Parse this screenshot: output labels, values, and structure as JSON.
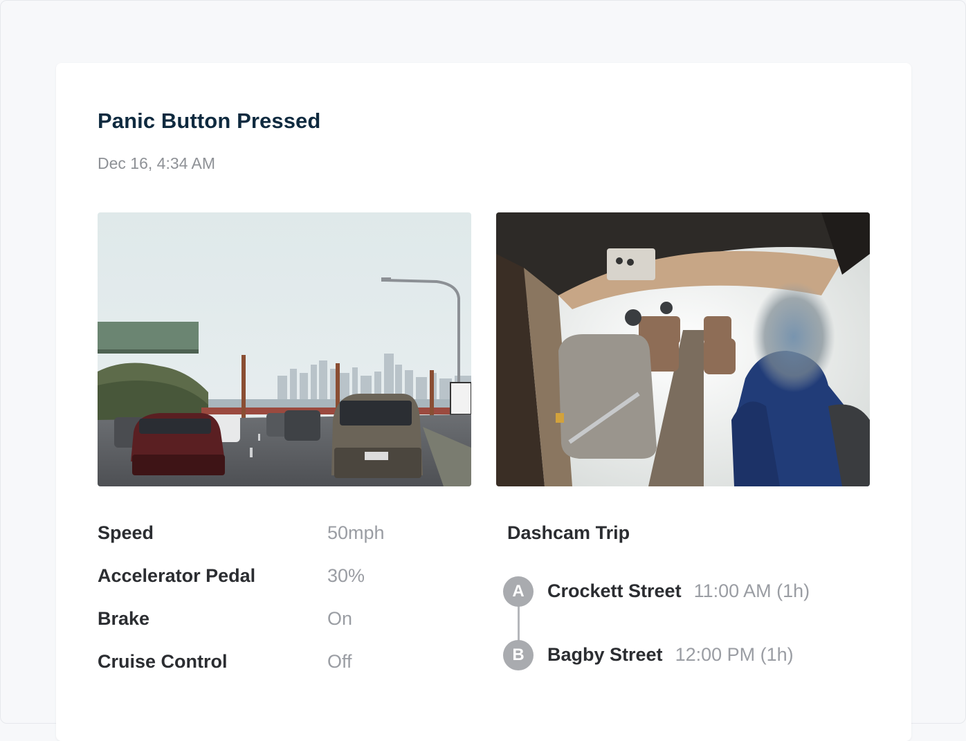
{
  "event": {
    "title": "Panic Button Pressed",
    "timestamp": "Dec 16, 4:34 AM"
  },
  "media": {
    "road_camera": "road-facing-dashcam-image",
    "cabin_camera": "driver-facing-dashcam-image"
  },
  "stats": [
    {
      "label": "Speed",
      "value": "50mph"
    },
    {
      "label": "Accelerator Pedal",
      "value": "30%"
    },
    {
      "label": "Brake",
      "value": "On"
    },
    {
      "label": "Cruise Control",
      "value": "Off"
    }
  ],
  "trip": {
    "title": "Dashcam Trip",
    "stops": [
      {
        "badge": "A",
        "name": "Crockett Street",
        "time": "11:00 AM (1h)"
      },
      {
        "badge": "B",
        "name": "Bagby Street",
        "time": "12:00 PM (1h)"
      }
    ]
  },
  "colors": {
    "title": "#0f2a3f",
    "muted": "#9a9da3",
    "badge": "#a9abaf"
  }
}
